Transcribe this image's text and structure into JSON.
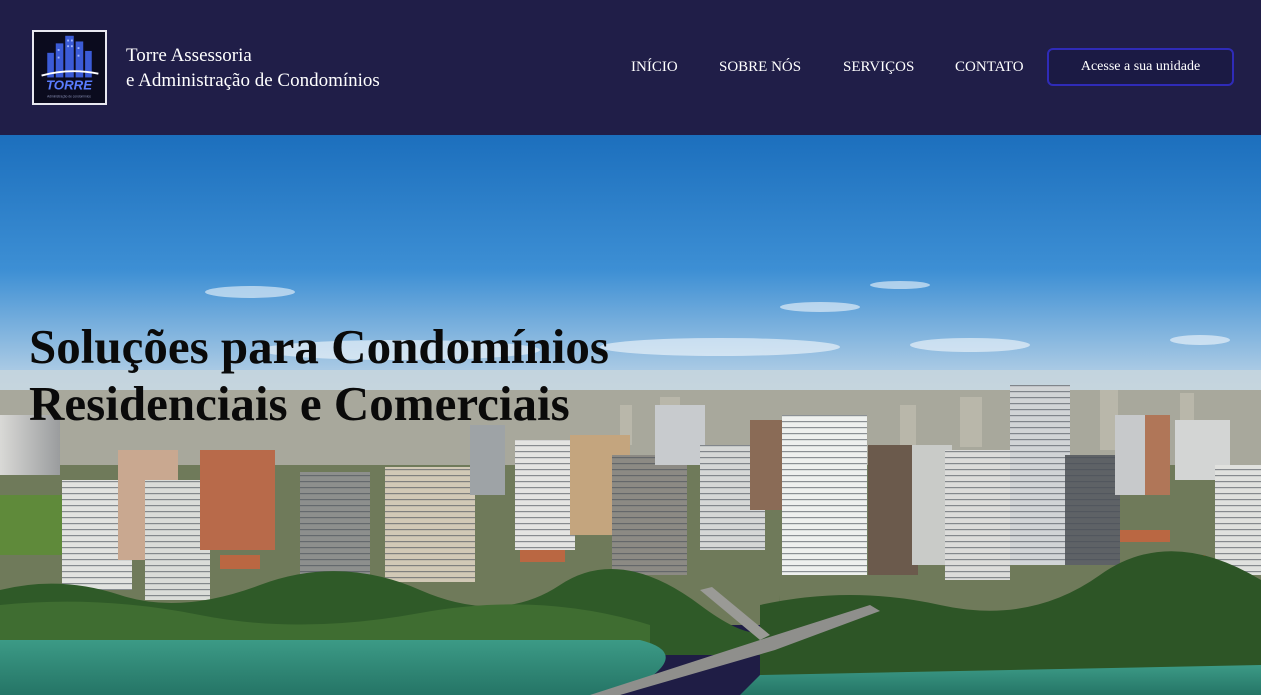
{
  "header": {
    "logo": {
      "text": "TORRE",
      "tagline": "Administração de condomínios",
      "icon": "buildings-logo-icon"
    },
    "brand_line1": "Torre Assessoria",
    "brand_line2": "e Administração de Condomínios",
    "nav": [
      {
        "label": "INÍCIO"
      },
      {
        "label": "SOBRE NÓS"
      },
      {
        "label": "SERVIÇOS"
      },
      {
        "label": "CONTATO"
      }
    ],
    "cta_label": "Acesse a sua unidade"
  },
  "hero": {
    "title_line1": "Soluções para Condomínios",
    "title_line2": "Residenciais e Comerciais",
    "image": "aerial-city-skyline-photo"
  },
  "colors": {
    "header_bg": "#201e48",
    "cta_border": "#2f2bb8",
    "text_light": "#ffffff",
    "hero_title": "#0a0a0a",
    "sky_top": "#1f78c4",
    "water": "#2f8a78"
  }
}
